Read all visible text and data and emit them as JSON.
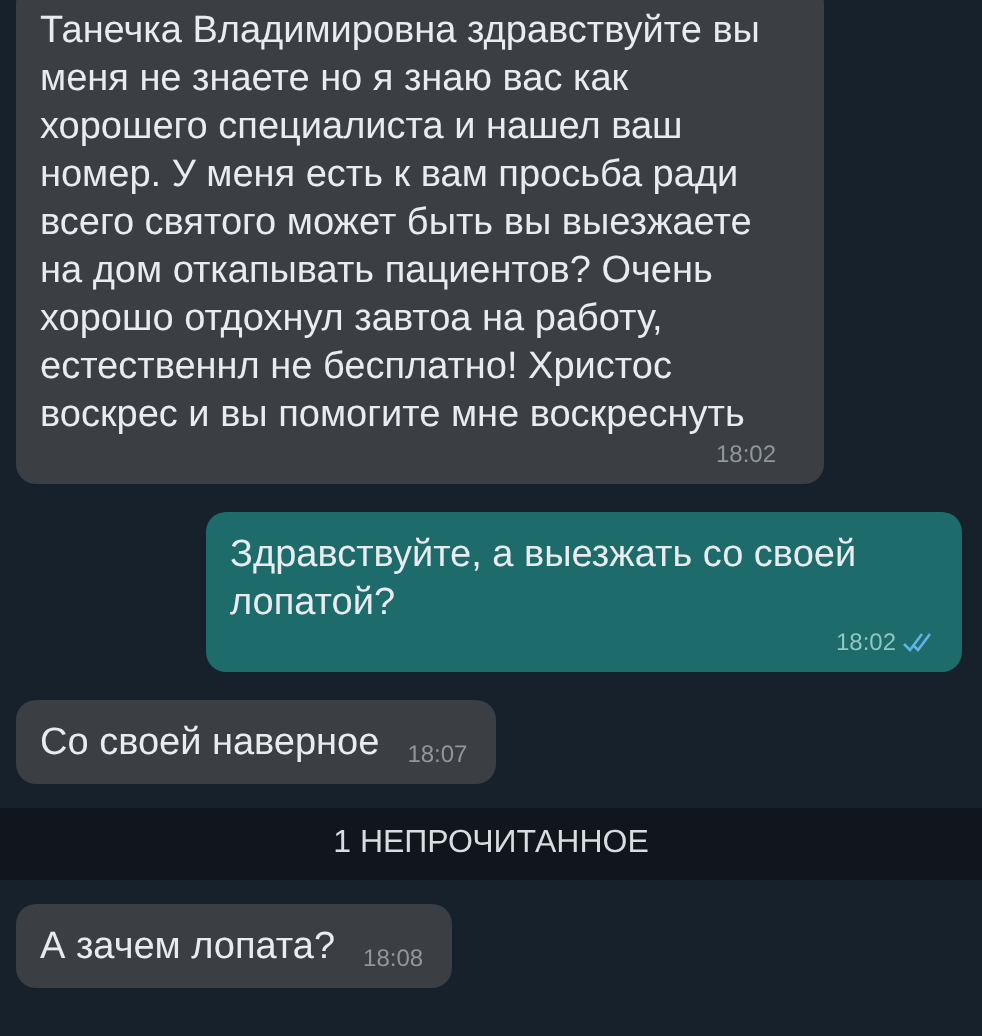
{
  "messages": [
    {
      "kind": "message",
      "outgoing": false,
      "text": "Танечка Владимировна здравствуйте вы меня не знаете но я знаю вас как хорошего специалиста и нашел ваш номер. У меня есть к вам просьба ради всего святого может быть вы выезжаете на дом откапывать пациентов? Очень хорошо отдохнул завтоа на работу, естественнл не бесплатно! Христос воскрес и вы помогите мне воскреснуть",
      "time": "18:02"
    },
    {
      "kind": "message",
      "outgoing": true,
      "text": "Здравствуйте, а выезжать со своей лопатой?",
      "time": "18:02",
      "read": true
    },
    {
      "kind": "message",
      "outgoing": false,
      "text": "Со своей наверное",
      "time": "18:07"
    },
    {
      "kind": "divider",
      "text": "1 НЕПРОЧИТАННОЕ"
    },
    {
      "kind": "message",
      "outgoing": false,
      "text": "А зачем лопата?",
      "time": "18:08"
    }
  ]
}
